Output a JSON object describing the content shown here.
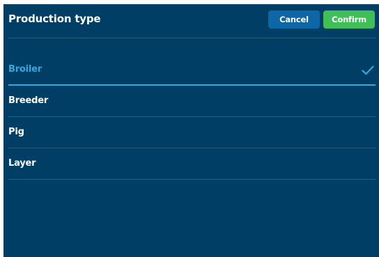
{
  "header": {
    "title": "Production type",
    "cancel_label": "Cancel",
    "confirm_label": "Confirm"
  },
  "options": [
    {
      "label": "Broiler",
      "selected": true,
      "icon": "checkmark-icon"
    },
    {
      "label": "Breeder",
      "selected": false
    },
    {
      "label": "Pig",
      "selected": false
    },
    {
      "label": "Layer",
      "selected": false
    }
  ],
  "colors": {
    "panel_background": "#003e66",
    "cancel_button": "#0d67a6",
    "confirm_button": "#40bf58",
    "selected_accent": "#35a8e0",
    "divider": "#2c5d80",
    "text": "#ffffff"
  }
}
